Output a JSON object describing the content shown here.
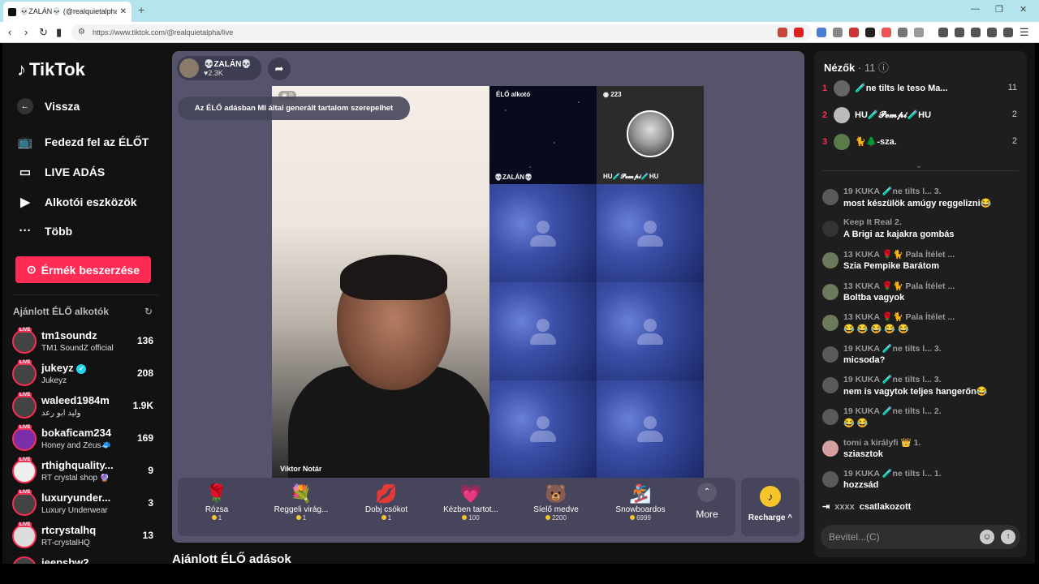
{
  "browser": {
    "tab_title": "💀ZALÁN💀 (@realquietalpha...",
    "url": "https://www.tiktok.com/@realquietalpha/live"
  },
  "sidebar": {
    "logo": "TikTok",
    "back": "Vissza",
    "nav": [
      "Fedezd fel az ÉLŐT",
      "LIVE ADÁS",
      "Alkotói eszközök",
      "Több"
    ],
    "coins_button": "Érmék beszerzése",
    "recommended_title": "Ajánlott ÉLŐ alkotók",
    "live_badge": "LIVE",
    "creators": [
      {
        "name": "tm1soundz",
        "sub": "TM1 SoundZ official",
        "count": "136",
        "verified": false
      },
      {
        "name": "jukeyz",
        "sub": "Jukeyz",
        "count": "208",
        "verified": true
      },
      {
        "name": "waleed1984m",
        "sub": "وليد ابو رعد",
        "count": "1.9K",
        "verified": false
      },
      {
        "name": "bokaficam234",
        "sub": "Honey and Zeus🧢",
        "count": "169",
        "verified": false
      },
      {
        "name": "rthighquality...",
        "sub": "RT crystal shop 🔮",
        "count": "9",
        "verified": false
      },
      {
        "name": "luxuryunder...",
        "sub": "Luxury Underwear",
        "count": "3",
        "verified": false
      },
      {
        "name": "rtcrystalhq",
        "sub": "RT-crystalHQ",
        "count": "13",
        "verified": false
      },
      {
        "name": "jeepsbw2",
        "sub": "",
        "count": "",
        "verified": false
      }
    ]
  },
  "stream": {
    "host_name": "💀ZALÁN💀",
    "host_likes": "♥2.3K",
    "ai_notice": "Az ÉLŐ adásban MI által generált tartalom szerepelhet",
    "main_count": "0",
    "main_name": "Viktor Notár",
    "cell_live_label": "ÉLŐ alkotó",
    "cell_host_label": "💀ZALÁN💀",
    "cell_count": "223",
    "cell_guest_label": "HU🧪𝓟𝓮𝓶𝓹𝓲🧪HU",
    "gifts": [
      {
        "icon": "🌹",
        "name": "Rózsa",
        "price": "1"
      },
      {
        "icon": "💐",
        "name": "Reggeli virág...",
        "price": "1"
      },
      {
        "icon": "💋",
        "name": "Dobj csókot",
        "price": "1"
      },
      {
        "icon": "💗",
        "name": "Kézben tartot...",
        "price": "100"
      },
      {
        "icon": "🐻",
        "name": "Síelő medve",
        "price": "2200"
      },
      {
        "icon": "🏂",
        "name": "Snowboardos",
        "price": "6999"
      }
    ],
    "more": "More",
    "recharge": "Recharge ^"
  },
  "below_title": "Ajánlott ÉLŐ adások",
  "chat": {
    "viewers_label": "Nézők",
    "viewers_count": "· 11",
    "top_viewers": [
      {
        "rank": "1",
        "name": "🧪ne tilts le teso Ma...",
        "count": "11"
      },
      {
        "rank": "2",
        "name": "HU🧪𝓟𝓮𝓶𝓹𝓲🧪HU",
        "count": "2"
      },
      {
        "rank": "3",
        "name": "🐈🌲-sza.",
        "count": "2"
      }
    ],
    "messages": [
      {
        "meta": "19 KUKA 🧪ne tilts l... 3.",
        "text": "most készülök amúgy reggelizni😂"
      },
      {
        "meta": "Keep It Real 2.",
        "text": "A Brigi az kajakra gombás"
      },
      {
        "meta": "13 KUKA 🌹🐈 Pala Ítélet ...",
        "text": "Szia Pempike Barátom"
      },
      {
        "meta": "13 KUKA 🌹🐈 Pala Ítélet ...",
        "text": "Boltba vagyok"
      },
      {
        "meta": "13 KUKA 🌹🐈 Pala Ítélet ...",
        "text": "😂 😂 😂 😂 😂"
      },
      {
        "meta": "19 KUKA 🧪ne tilts l... 3.",
        "text": "micsoda?"
      },
      {
        "meta": "19 KUKA 🧪ne tilts l... 3.",
        "text": "nem is vagytok teljes hangerőn😂"
      },
      {
        "meta": "19 KUKA 🧪ne tilts l... 2.",
        "text": "😂 😂"
      },
      {
        "meta": "tomi a királyfi 👑 1.",
        "text": "sziasztok"
      },
      {
        "meta": "19 KUKA 🧪ne tilts l... 1.",
        "text": "hozzsád"
      }
    ],
    "join_name": "xxxx",
    "join_text": "csatlakozott",
    "input_placeholder": "Bevitel...(C)"
  }
}
